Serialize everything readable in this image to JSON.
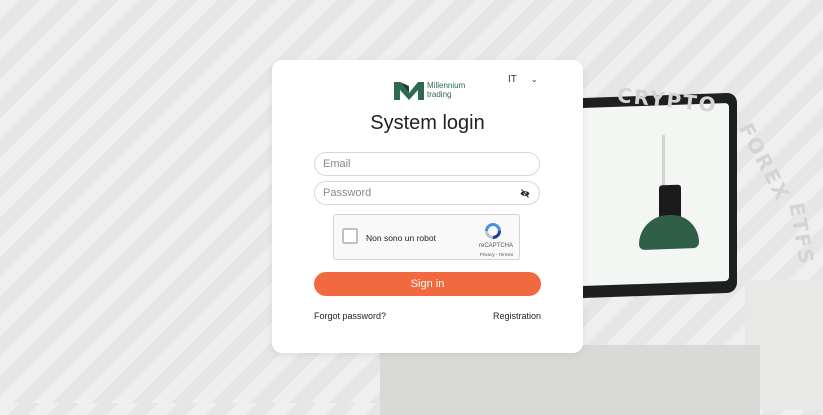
{
  "background": {
    "words": [
      "CRYPTO",
      "FOREX",
      "ETFS"
    ]
  },
  "brand": {
    "name_line1": "Millennium",
    "name_line2": "trading",
    "color": "#2d6a4f"
  },
  "language": {
    "selected": "IT"
  },
  "login": {
    "title": "System login",
    "email_placeholder": "Email",
    "password_placeholder": "Password",
    "captcha_label": "Non sono un robot",
    "captcha_brand": "reCAPTCHA",
    "captcha_links": "Privacy - Termini",
    "signin_label": "Sign in",
    "forgot_label": "Forgot password?",
    "register_label": "Registration"
  },
  "colors": {
    "accent": "#f2683f",
    "brand_green": "#2d6a4f"
  },
  "icons": {
    "password_toggle": "eye-slash-icon",
    "captcha": "recaptcha-icon",
    "language": "chevron-down-icon"
  }
}
